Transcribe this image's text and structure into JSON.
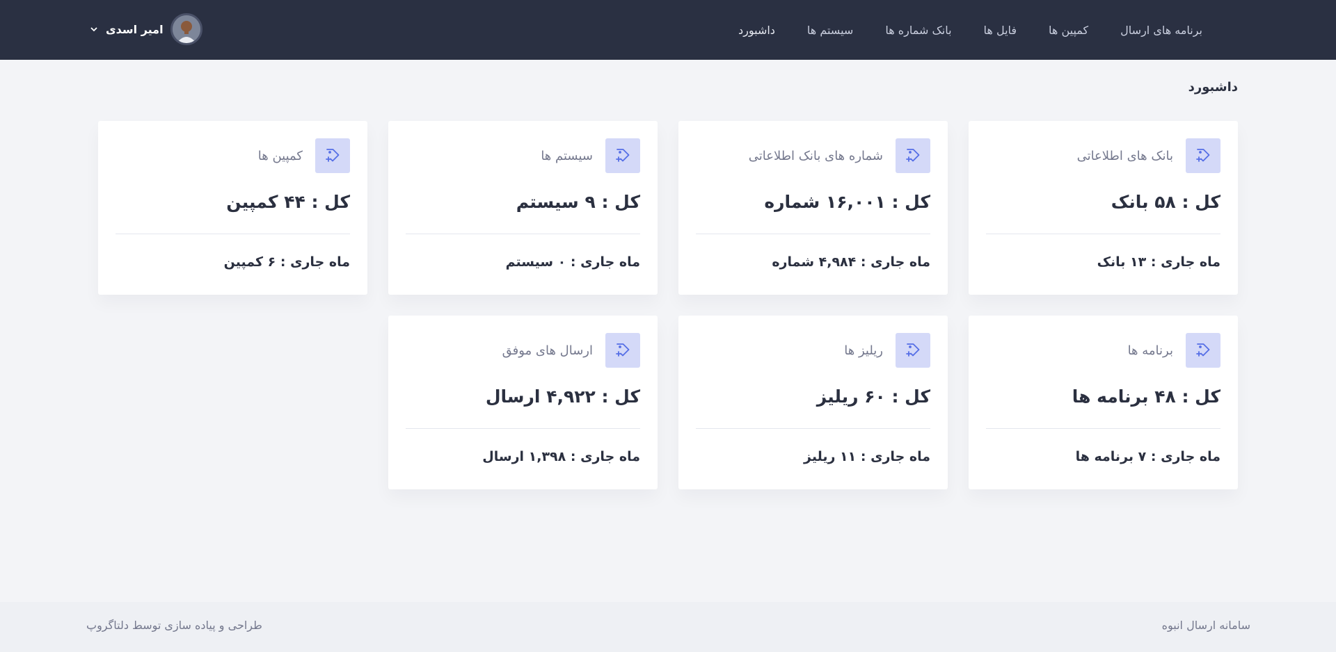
{
  "header": {
    "nav": [
      {
        "label": "داشبورد"
      },
      {
        "label": "سیستم ها"
      },
      {
        "label": "بانک شماره ها"
      },
      {
        "label": "فایل ها"
      },
      {
        "label": "کمپین ها"
      },
      {
        "label": "برنامه های ارسال"
      }
    ],
    "user": {
      "name": "امیر اسدی"
    }
  },
  "page": {
    "title": "داشبورد"
  },
  "cards": [
    {
      "title": "بانک های اطلاعاتی",
      "total": "کل : ۵۸ بانک",
      "month": "ماه جاری : ۱۳ بانک"
    },
    {
      "title": "شماره های بانک اطلاعاتی",
      "total": "کل : ۱۶,۰۰۱ شماره",
      "month": "ماه جاری : ۴,۹۸۴ شماره"
    },
    {
      "title": "سیستم ها",
      "total": "کل : ۹ سیستم",
      "month": "ماه جاری : ۰ سیستم"
    },
    {
      "title": "کمپین ها",
      "total": "کل : ۴۴ کمپین",
      "month": "ماه جاری : ۶ کمپین"
    },
    {
      "title": "برنامه ها",
      "total": "کل : ۴۸ برنامه ها",
      "month": "ماه جاری : ۷ برنامه ها"
    },
    {
      "title": "ریلیز ها",
      "total": "کل : ۶۰ ریلیز",
      "month": "ماه جاری : ۱۱ ریلیز"
    },
    {
      "title": "ارسال های موفق",
      "total": "کل : ۴,۹۲۲ ارسال",
      "month": "ماه جاری : ۱,۳۹۸ ارسال"
    }
  ],
  "footer": {
    "left": "طراحی و پیاده سازی توسط دلتاگروپ",
    "right": "سامانه ارسال انبوه"
  },
  "colors": {
    "header_bg": "#2a3042",
    "page_bg": "#f3f4f7",
    "icon_bg": "#d4d9f8",
    "icon_stroke": "#556ee6"
  }
}
